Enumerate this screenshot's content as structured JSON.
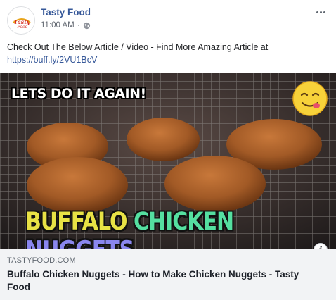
{
  "post": {
    "page_name": "Tasty Food",
    "timestamp": "11:00 AM",
    "separator": "·",
    "avatar_logo_text": "Tasty Food",
    "text_line": "Check Out The Below Article / Video - Find More Amazing Article at",
    "link_url": "https://buff.ly/2VU1BcV"
  },
  "media": {
    "overlay_top": "LETS DO IT AGAIN!",
    "overlay_bottom_word1": "BUFFALO",
    "overlay_bottom_word2": "CHICKEN",
    "overlay_bottom_word3": "NUGGETS",
    "info_label": "i",
    "colors": {
      "buffalo": "#e8e245",
      "chicken_start": "#5fe36a",
      "chicken_end": "#4ad7e8",
      "nuggets_start": "#48a6f2",
      "nuggets_end": "#c064e6"
    }
  },
  "link_preview": {
    "domain": "TASTYFOOD.COM",
    "title": "Buffalo Chicken Nuggets - How to Make Chicken Nuggets - Tasty Food"
  },
  "icons": {
    "more": "more-options-icon",
    "globe": "globe-icon",
    "emoji": "yum-face-emoji-icon",
    "info": "info-icon"
  },
  "accent_color": "#365899"
}
